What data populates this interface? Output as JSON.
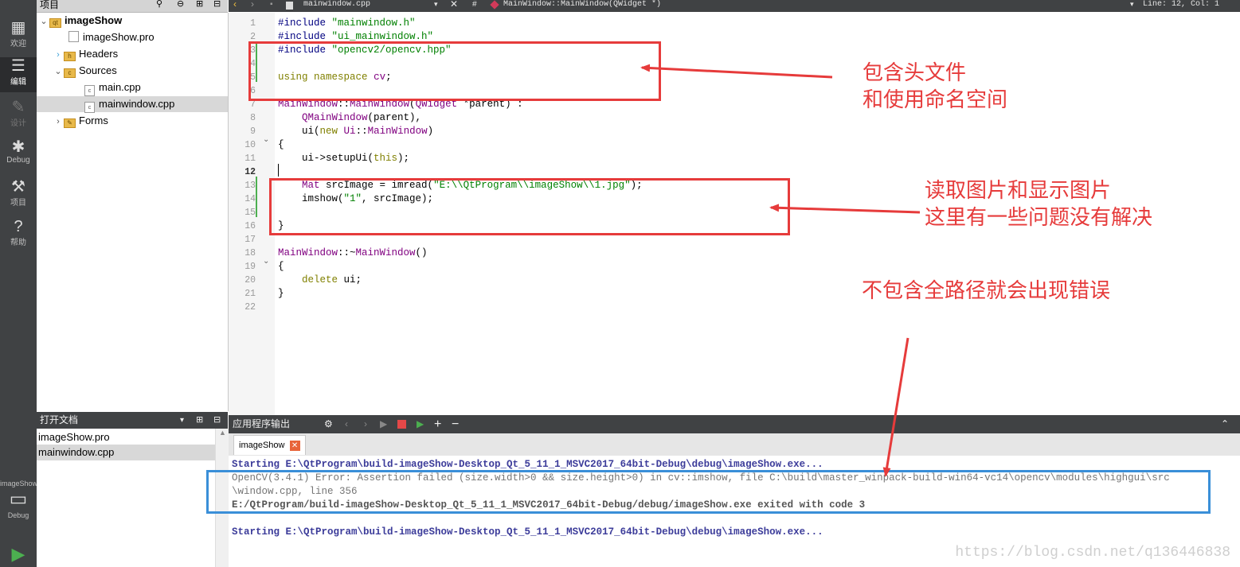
{
  "left_modes": [
    {
      "label": "欢迎",
      "icon": "grid-icon"
    },
    {
      "label": "编辑",
      "icon": "edit-icon",
      "active": true
    },
    {
      "label": "设计",
      "icon": "pencil-icon",
      "disabled": true
    },
    {
      "label": "Debug",
      "icon": "bug-icon"
    },
    {
      "label": "项目",
      "icon": "wrench-icon"
    },
    {
      "label": "帮助",
      "icon": "help-icon"
    }
  ],
  "kit": {
    "project": "imageShow",
    "mode": "Debug"
  },
  "project_pane": {
    "title": "项目",
    "tree": [
      {
        "label": "imageShow",
        "level": 0,
        "expanded": true,
        "bold": true
      },
      {
        "label": "imageShow.pro",
        "level": 1
      },
      {
        "label": "Headers",
        "level": 1,
        "expanded": false
      },
      {
        "label": "Sources",
        "level": 1,
        "expanded": true
      },
      {
        "label": "main.cpp",
        "level": 2
      },
      {
        "label": "mainwindow.cpp",
        "level": 2,
        "selected": true
      },
      {
        "label": "Forms",
        "level": 1,
        "expanded": false
      }
    ]
  },
  "open_docs": {
    "title": "打开文档",
    "items": [
      "imageShow.pro",
      "mainwindow.cpp"
    ]
  },
  "editor": {
    "filename": "mainwindow.cpp",
    "symbol": "MainWindow::MainWindow(QWidget *)",
    "position": "Line: 12, Col: 1",
    "line_numbers": [
      "1",
      "2",
      "3",
      "4",
      "5",
      "6",
      "7",
      "8",
      "9",
      "10",
      "11",
      "12",
      "13",
      "14",
      "15",
      "16",
      "17",
      "18",
      "19",
      "20",
      "21",
      "22"
    ],
    "code": [
      "#include \"mainwindow.h\"",
      "#include \"ui_mainwindow.h\"",
      "#include \"opencv2/opencv.hpp\"",
      "",
      "using namespace cv;",
      "",
      "MainWindow::MainWindow(QWidget *parent) :",
      "    QMainWindow(parent),",
      "    ui(new Ui::MainWindow)",
      "{",
      "    ui->setupUi(this);",
      "",
      "    Mat srcImage = imread(\"E:\\\\QtProgram\\\\imageShow\\\\1.jpg\");",
      "    imshow(\"1\", srcImage);",
      "",
      "}",
      "",
      "MainWindow::~MainWindow()",
      "{",
      "    delete ui;",
      "}",
      ""
    ]
  },
  "output": {
    "title": "应用程序输出",
    "tab": "imageShow",
    "lines": [
      "Starting E:\\QtProgram\\build-imageShow-Desktop_Qt_5_11_1_MSVC2017_64bit-Debug\\debug\\imageShow.exe...",
      "OpenCV(3.4.1) Error: Assertion failed (size.width>0 && size.height>0) in cv::imshow, file C:\\build\\master_winpack-build-win64-vc14\\opencv\\modules\\highgui\\src",
      "\\window.cpp, line 356",
      "E:/QtProgram/build-imageShow-Desktop_Qt_5_11_1_MSVC2017_64bit-Debug/debug/imageShow.exe exited with code 3",
      "",
      "Starting E:\\QtProgram\\build-imageShow-Desktop_Qt_5_11_1_MSVC2017_64bit-Debug\\debug\\imageShow.exe..."
    ]
  },
  "annotations": {
    "note1_line1": "包含头文件",
    "note1_line2": "和使用命名空间",
    "note2_line1": "读取图片和显示图片",
    "note2_line2": "这里有一些问题没有解决",
    "note3": "不包含全路径就会出现错误",
    "red": "#e63b3b",
    "blue": "#3a8fd8"
  },
  "watermark": "https://blog.csdn.net/q136446838"
}
